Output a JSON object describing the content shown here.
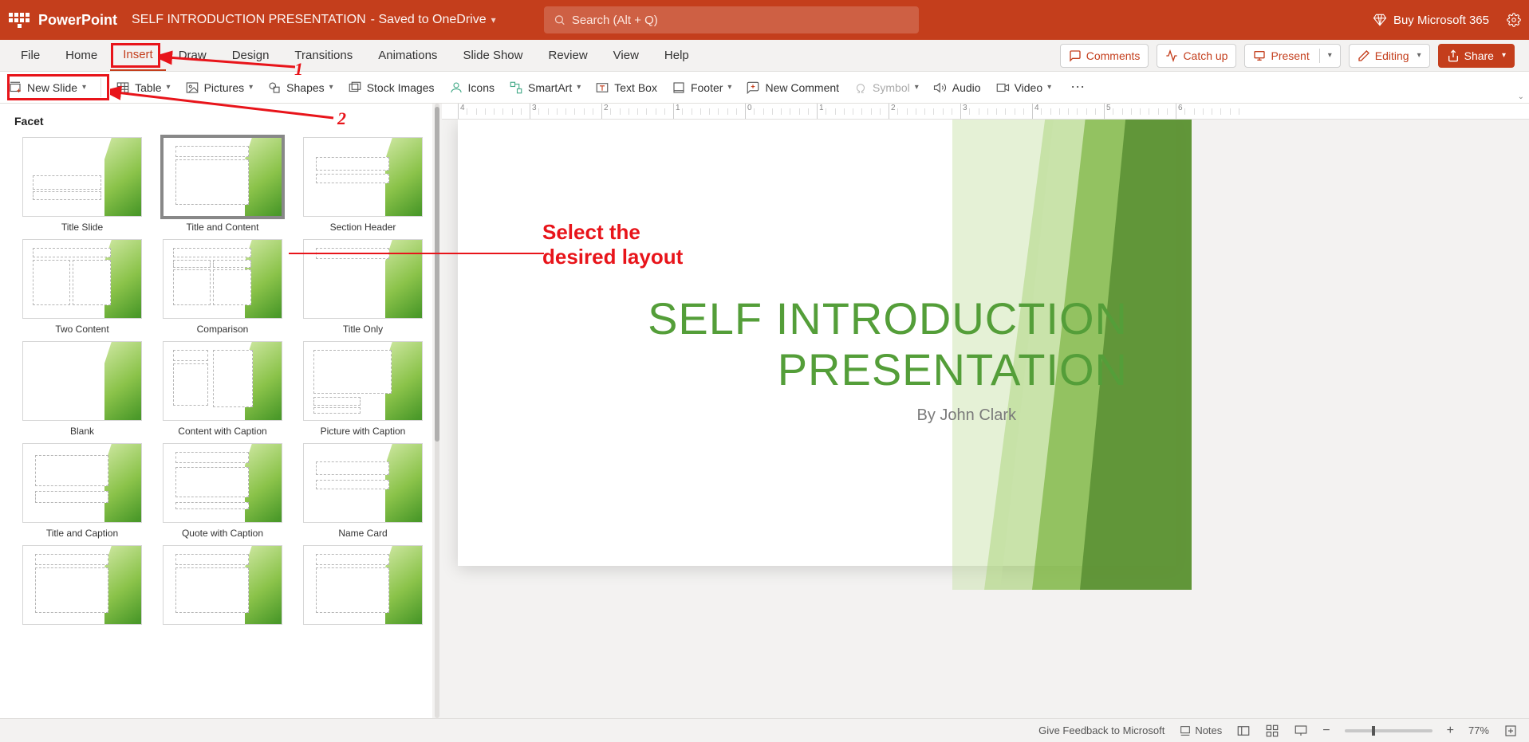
{
  "titlebar": {
    "app_name": "PowerPoint",
    "doc_name": "SELF INTRODUCTION PRESENTATION",
    "saved_suffix": " - Saved to OneDrive",
    "search_placeholder": "Search (Alt + Q)",
    "buy_label": "Buy Microsoft 365"
  },
  "tabs": {
    "items": [
      "File",
      "Home",
      "Insert",
      "Draw",
      "Design",
      "Transitions",
      "Animations",
      "Slide Show",
      "Review",
      "View",
      "Help"
    ],
    "active_index": 2
  },
  "tab_actions": {
    "comments": "Comments",
    "catchup": "Catch up",
    "present": "Present",
    "editing": "Editing",
    "share": "Share"
  },
  "ribbon": {
    "new_slide": "New Slide",
    "table": "Table",
    "pictures": "Pictures",
    "shapes": "Shapes",
    "stock_images": "Stock Images",
    "icons": "Icons",
    "smartart": "SmartArt",
    "text_box": "Text Box",
    "footer": "Footer",
    "new_comment": "New Comment",
    "symbol": "Symbol",
    "audio": "Audio",
    "video": "Video"
  },
  "gallery": {
    "title": "Facet",
    "layouts": [
      "Title Slide",
      "Title and Content",
      "Section Header",
      "Two Content",
      "Comparison",
      "Title Only",
      "Blank",
      "Content with Caption",
      "Picture with Caption",
      "Title and Caption",
      "Quote with Caption",
      "Name Card",
      "",
      "",
      ""
    ],
    "selected_index": 1
  },
  "annotations": {
    "step1": "1",
    "step2": "2",
    "select_line1": "Select the",
    "select_line2": "desired layout"
  },
  "ruler": {
    "labels": [
      "4",
      "3",
      "2",
      "1",
      "0",
      "1",
      "2",
      "3",
      "4",
      "5",
      "6"
    ]
  },
  "slide": {
    "title_l1": "SELF INTRODUCTION",
    "title_l2": "PRESENTATION",
    "subtitle": "By John Clark"
  },
  "status": {
    "feedback": "Give Feedback to Microsoft",
    "notes": "Notes",
    "zoom": "77%"
  }
}
